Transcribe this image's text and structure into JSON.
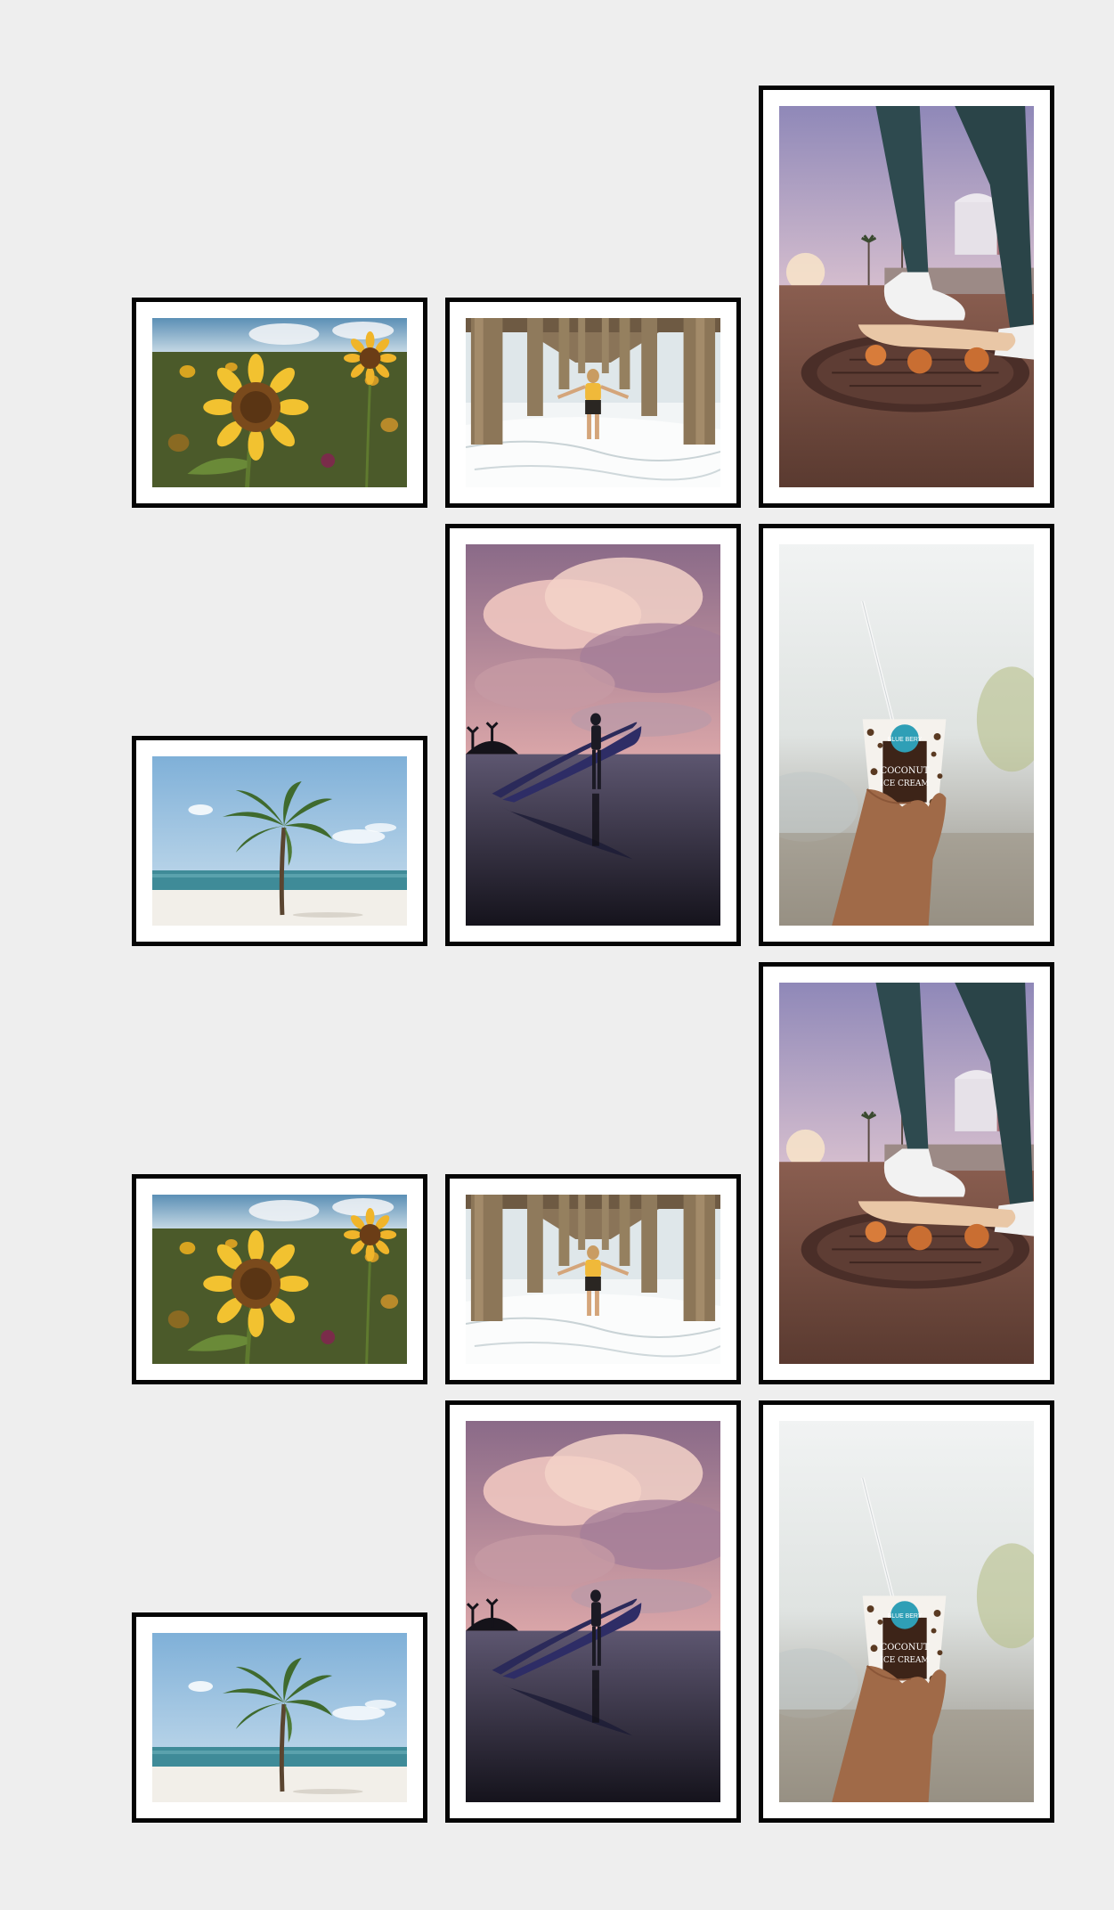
{
  "gallery": {
    "frames": [
      {
        "subject": "sunflowers",
        "orientation": "landscape"
      },
      {
        "subject": "pier-woman",
        "orientation": "landscape"
      },
      {
        "subject": "skateboard",
        "orientation": "portrait"
      },
      {
        "subject": "palm-beach",
        "orientation": "landscape"
      },
      {
        "subject": "surfer-sunset",
        "orientation": "portrait"
      },
      {
        "subject": "ice-cream-cup",
        "orientation": "portrait"
      },
      {
        "subject": "sunflowers",
        "orientation": "landscape"
      },
      {
        "subject": "pier-woman",
        "orientation": "landscape"
      },
      {
        "subject": "skateboard",
        "orientation": "portrait"
      },
      {
        "subject": "palm-beach",
        "orientation": "landscape"
      },
      {
        "subject": "surfer-sunset",
        "orientation": "portrait"
      },
      {
        "subject": "ice-cream-cup",
        "orientation": "portrait"
      }
    ]
  },
  "cup_label": {
    "brand": "BLUE BERY",
    "line1": "COCONUT",
    "line2": "ICE CREAM"
  }
}
